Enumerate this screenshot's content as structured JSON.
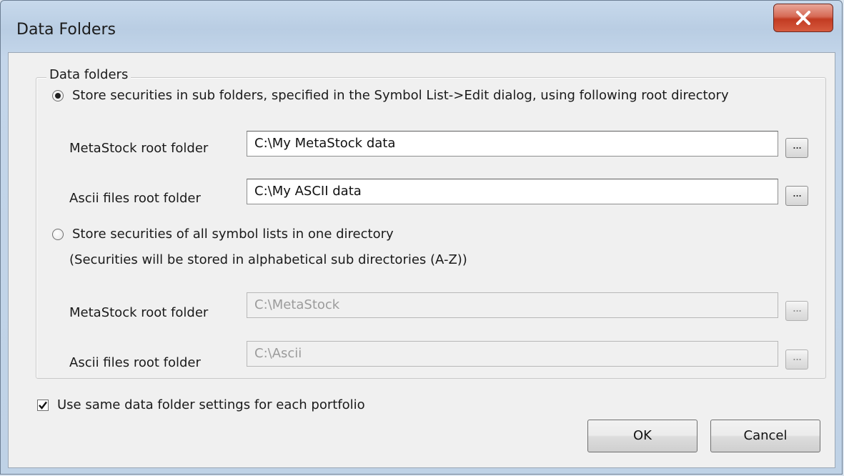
{
  "window": {
    "title": "Data Folders"
  },
  "group": {
    "legend": "Data folders"
  },
  "option_subfolders": {
    "label": "Store securities in sub folders, specified in the Symbol List->Edit dialog, using following root directory",
    "selected": true,
    "metastock_label": "MetaStock root folder",
    "metastock_value": "C:\\My MetaStock data",
    "ascii_label": "Ascii files root folder",
    "ascii_value": "C:\\My ASCII data"
  },
  "option_one_directory": {
    "label": "Store securities of all symbol lists in one directory",
    "selected": false,
    "note": "(Securities will be stored in alphabetical sub directories (A-Z))",
    "metastock_label": "MetaStock root folder",
    "metastock_value": "C:\\MetaStock",
    "ascii_label": "Ascii files root folder",
    "ascii_value": "C:\\Ascii"
  },
  "browse_label": "...",
  "same_settings": {
    "label": "Use same data folder settings for each portfolio",
    "checked": true
  },
  "buttons": {
    "ok": "OK",
    "cancel": "Cancel"
  }
}
